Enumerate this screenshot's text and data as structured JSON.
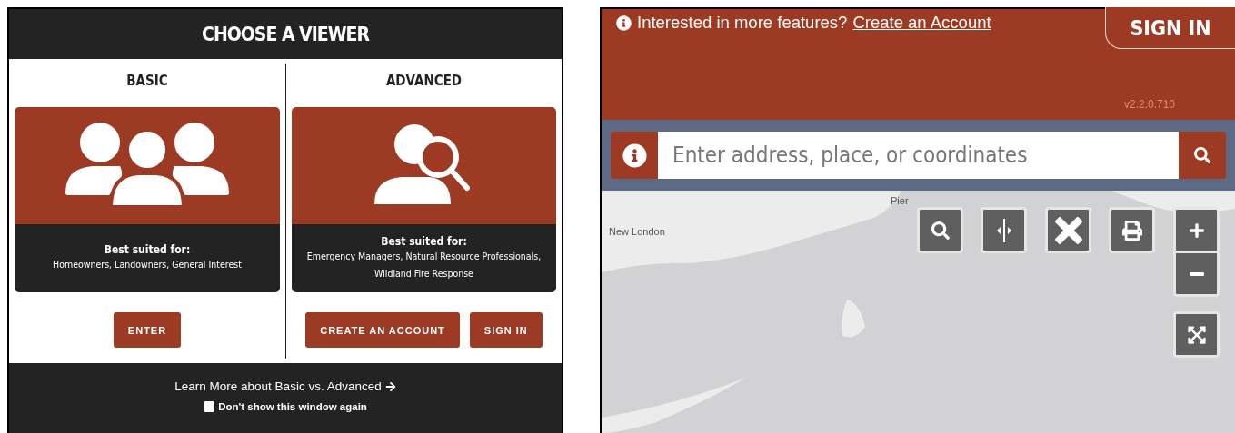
{
  "viewer_dialog": {
    "title": "CHOOSE A VIEWER",
    "options": [
      {
        "heading": "BASIC",
        "kind": "group",
        "best_for_label": "Best suited for:",
        "audience": "Homeowners, Landowners, General Interest",
        "buttons": [
          "ENTER"
        ]
      },
      {
        "heading": "ADVANCED",
        "kind": "search",
        "best_for_label": "Best suited for:",
        "audience": "Emergency Managers, Natural Resource Professionals, Wildland Fire Response",
        "buttons": [
          "CREATE AN ACCOUNT",
          "SIGN IN"
        ]
      }
    ],
    "learn_more_link": "Learn More about Basic vs. Advanced",
    "dont_show_again": {
      "label": "Don't show this window again",
      "checked": false
    }
  },
  "map_viewer": {
    "banner_text": "Interested in more features?",
    "banner_link": "Create an Account",
    "sign_in_button": "SIGN IN",
    "version": "v2.2.0.710",
    "search": {
      "placeholder": "Enter address, place, or coordinates"
    },
    "map_labels": [
      "New London",
      "Pier"
    ]
  }
}
